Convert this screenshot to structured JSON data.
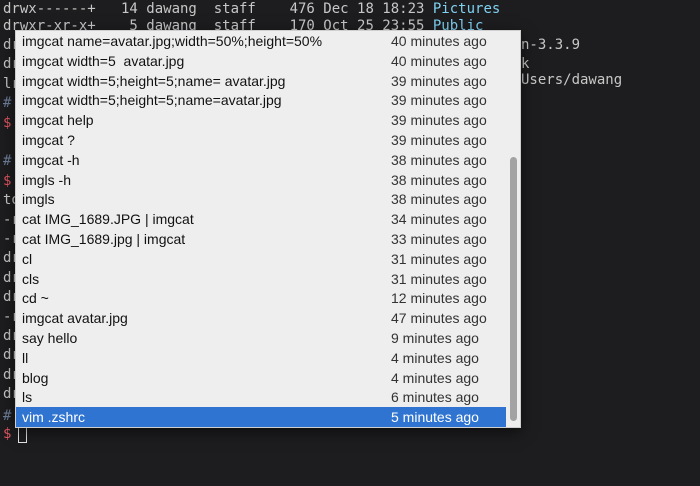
{
  "terminal": {
    "lines": [
      {
        "a": "drwx------+",
        "b": "   14 dawang  staff    476 Dec 18 18:23 ",
        "dir": "Pictures"
      },
      {
        "a": "drwxr-xr-x+",
        "b": "    5 dawang  staff    170 Oct 25 23:55 ",
        "dir": "Public"
      }
    ],
    "left_fragments": [
      "dr",
      "dr",
      "lr",
      "#",
      "$",
      "",
      "#",
      "$",
      "to",
      "-r",
      "-r",
      "dr",
      "dr",
      "dr",
      "-r",
      "dr",
      "dr",
      "dr",
      "dr"
    ],
    "right_fragments": [
      "n-3.3.9",
      "k",
      "Users/dawang"
    ],
    "prompt_hash": "#",
    "prompt_symbol": "$"
  },
  "autocomplete": {
    "selected_index": 19,
    "items": [
      {
        "command": "imgcat name=avatar.jpg;width=50%;height=50%",
        "time": "40 minutes ago"
      },
      {
        "command": "imgcat width=5  avatar.jpg",
        "time": "40 minutes ago"
      },
      {
        "command": "imgcat width=5;height=5;name= avatar.jpg",
        "time": "39 minutes ago"
      },
      {
        "command": "imgcat width=5;height=5;name=avatar.jpg",
        "time": "39 minutes ago"
      },
      {
        "command": "imgcat help",
        "time": "39 minutes ago"
      },
      {
        "command": "imgcat ?",
        "time": "39 minutes ago"
      },
      {
        "command": "imgcat -h",
        "time": "38 minutes ago"
      },
      {
        "command": "imgls -h",
        "time": "38 minutes ago"
      },
      {
        "command": "imgls",
        "time": "38 minutes ago"
      },
      {
        "command": "cat IMG_1689.JPG | imgcat",
        "time": "34 minutes ago"
      },
      {
        "command": "cat IMG_1689.jpg | imgcat",
        "time": "33 minutes ago"
      },
      {
        "command": "cl",
        "time": "31 minutes ago"
      },
      {
        "command": "cls",
        "time": "31 minutes ago"
      },
      {
        "command": "cd ~",
        "time": "12 minutes ago"
      },
      {
        "command": "imgcat avatar.jpg",
        "time": "47 minutes ago"
      },
      {
        "command": "say hello",
        "time": "9 minutes ago"
      },
      {
        "command": "ll",
        "time": "4 minutes ago"
      },
      {
        "command": "blog",
        "time": "4 minutes ago"
      },
      {
        "command": "ls",
        "time": "6 minutes ago"
      },
      {
        "command": "vim .zshrc",
        "time": "5 minutes ago"
      }
    ]
  }
}
